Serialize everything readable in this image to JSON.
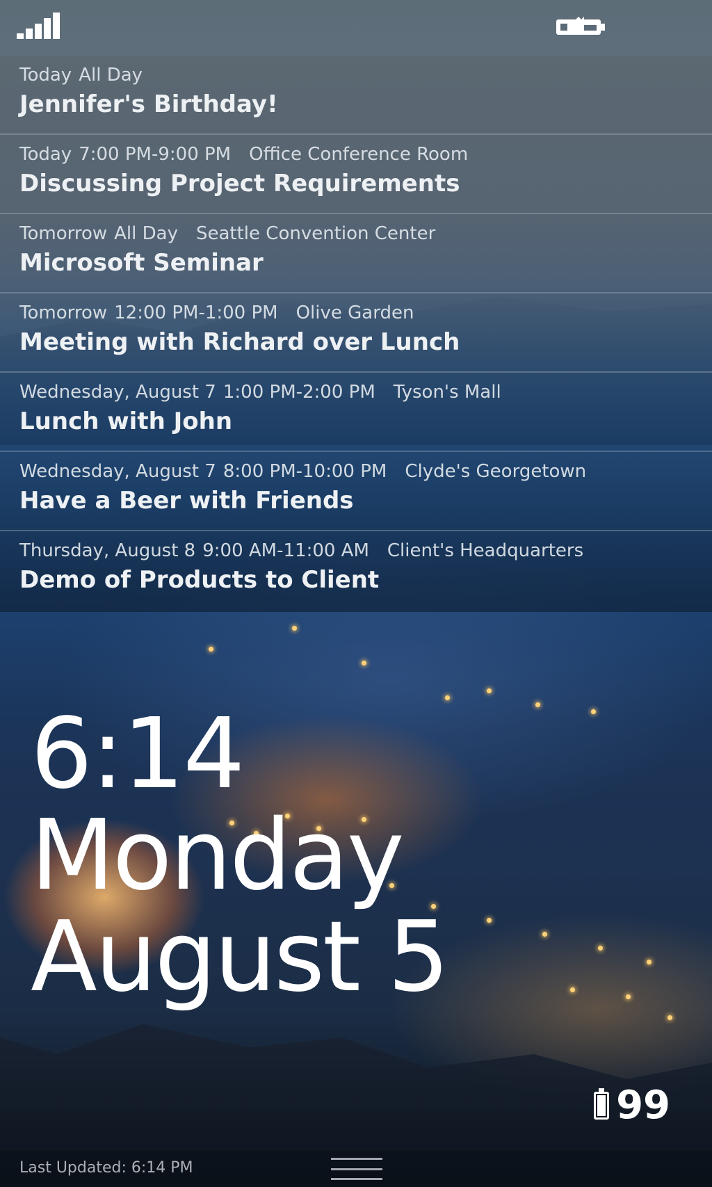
{
  "colors": {
    "text": "#ffffff",
    "meta_text": "#e1e6ec",
    "divider": "#b4bec8"
  },
  "status_bar": {
    "signal_icon": "signal-strength-icon",
    "notification_icon": "lockscreen-notification-icon"
  },
  "agenda": {
    "events": [
      {
        "when": "Today",
        "time": "All Day",
        "location": "",
        "title": "Jennifer's Birthday!"
      },
      {
        "when": "Today",
        "time": "7:00 PM-9:00 PM",
        "location": "Office Conference Room",
        "title": "Discussing Project Requirements"
      },
      {
        "when": "Tomorrow",
        "time": "All Day",
        "location": "Seattle Convention Center",
        "title": "Microsoft Seminar"
      },
      {
        "when": "Tomorrow",
        "time": "12:00 PM-1:00 PM",
        "location": "Olive Garden",
        "title": "Meeting with Richard over Lunch"
      },
      {
        "when": "Wednesday, August 7",
        "time": "1:00 PM-2:00 PM",
        "location": "Tyson's Mall",
        "title": "Lunch with John"
      },
      {
        "when": "Wednesday, August 7",
        "time": "8:00 PM-10:00 PM",
        "location": "Clyde's Georgetown",
        "title": "Have a Beer with Friends"
      },
      {
        "when": "Thursday, August 8",
        "time": "9:00 AM-11:00 AM",
        "location": "Client's Headquarters",
        "title": "Demo of Products to Client"
      }
    ]
  },
  "clock": {
    "time": "6:14",
    "day": "Monday",
    "date": "August 5"
  },
  "battery": {
    "icon": "battery-icon",
    "level": 99,
    "label": "99"
  },
  "footer": {
    "last_updated": "Last Updated: 6:14 PM",
    "handle_icon": "drag-handle-icon"
  }
}
